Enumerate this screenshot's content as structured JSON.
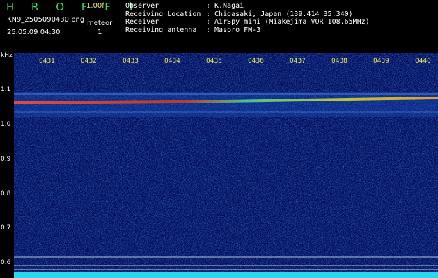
{
  "header": {
    "logo": "H R O F F T",
    "version": "1.00f",
    "filename": "KN9_2505090430.png",
    "mode": "meteor",
    "timestamp": "25.05.09 04:30",
    "mode_number": "1",
    "info": [
      {
        "label": "Observer",
        "value": "K.Nagai"
      },
      {
        "label": "Receiving Location",
        "value": "Chigasaki, Japan (139.414 35.340)"
      },
      {
        "label": "Receiver",
        "value": "AirSpy mini (Miakejima VOR 108.65MHz)"
      },
      {
        "label": "Receiving antenna",
        "value": "Maspro FM-3"
      }
    ]
  },
  "spectrogram": {
    "unit": "kHz",
    "freq_ticks": [
      "1.1",
      "1.0",
      "0.9",
      "0.8",
      "0.7",
      "0.6"
    ],
    "time_ticks": [
      "0431",
      "0432",
      "0433",
      "0434",
      "0435",
      "0436",
      "0437",
      "0438",
      "0439",
      "0440"
    ],
    "signal_freq_khz": 1.065,
    "colors": {
      "background": "#050a58",
      "trace": "#d23a3a",
      "baseline": "#29d5ef",
      "ticks": "#ece95a",
      "logo": "#2fe46b"
    }
  }
}
